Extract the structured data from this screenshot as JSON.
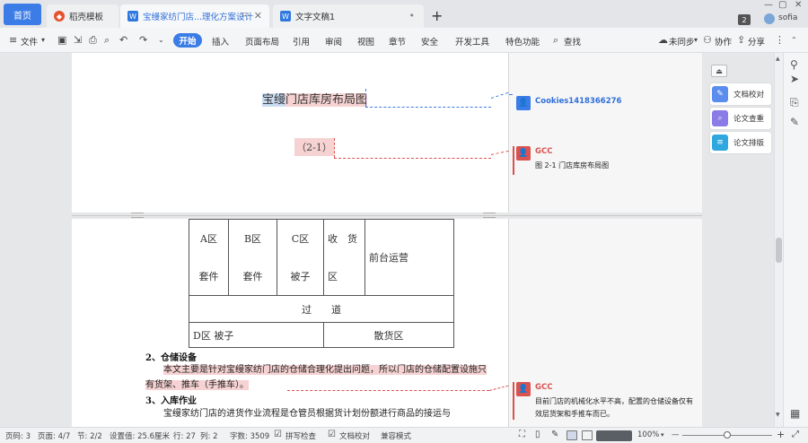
{
  "tabbar": {
    "home": "首页",
    "tabs": [
      {
        "label": "稻壳模板"
      },
      {
        "label": "宝缦家纺门店...理化方案设计"
      },
      {
        "label": "文字文稿1"
      }
    ],
    "window_badge": "2",
    "user_name": "sofia"
  },
  "ribbon": {
    "file": "文件",
    "tabs": [
      "开始",
      "插入",
      "页面布局",
      "引用",
      "审阅",
      "视图",
      "章节",
      "安全",
      "开发工具",
      "特色功能"
    ],
    "search": "查找",
    "sync": "未同步",
    "collab": "协作",
    "share": "分享"
  },
  "doc": {
    "page1": {
      "heading_selected": "宝缦",
      "heading_rest": "门店库房布局图",
      "figure_number": "（2-1）"
    },
    "table": {
      "row1": [
        {
          "top": "A区",
          "bottom": "套件"
        },
        {
          "top": "B区",
          "bottom": "套件"
        },
        {
          "top": "C区",
          "bottom": "被子"
        },
        {
          "top": "收　货",
          "bottom": "区"
        },
        {
          "single": "前台运营"
        }
      ],
      "aisle": "过　　道",
      "row3": [
        "D区  被子",
        "散货区"
      ]
    },
    "s2_title": "2、仓储设备",
    "s2_text": "本文主要是针对宝缦家纺门店的仓储合理化提出问题，所以门店的仓储配置设施只有货架、推车（手推车）。",
    "s3_title": "3、入库作业",
    "s3_text": "宝缦家纺门店的进货作业流程是仓管员根据货计划份额进行商品的接运与"
  },
  "comments": [
    {
      "author": "Cookies1418366276",
      "text": "",
      "color": "#3b7ce6"
    },
    {
      "author": "GCC",
      "text": "图 2-1 门店库房布局图",
      "color": "#d9534f"
    },
    {
      "author": "GCC",
      "text": "目前门店的机械化水平不高，配置的仓储设备仅有效层货架和手推车而已。",
      "color": "#d9534f"
    }
  ],
  "tools": [
    "文档校对",
    "论文查重",
    "论文排版"
  ],
  "status": {
    "page_code": "页码: 3",
    "page": "页面: 4/7",
    "section": "节: 2/2",
    "setting": "设置值: 25.6厘米",
    "row": "行: 27",
    "col": "列: 2",
    "words": "字数: 3509",
    "spell": "拼写检查",
    "proof": "文档校对",
    "compat": "兼容模式",
    "zoom": "100%"
  }
}
